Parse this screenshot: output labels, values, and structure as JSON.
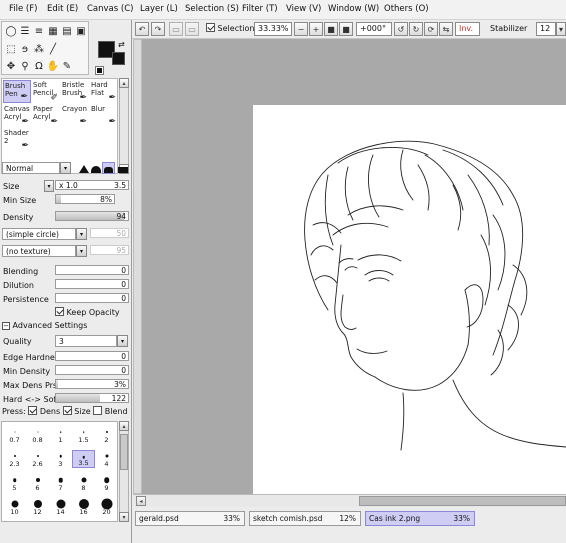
{
  "menu": [
    "File (F)",
    "Edit (E)",
    "Canvas (C)",
    "Layer (L)",
    "Selection (S)",
    "Filter (T)",
    "View (V)",
    "Window (W)",
    "Others (O)"
  ],
  "toolbar": {
    "selection_label": "Selection",
    "zoom": "33.33%",
    "rotation": "+000°",
    "invert_label": "Inv.",
    "stabilizer_label": "Stabilizer",
    "stabilizer_value": "12"
  },
  "brushes": [
    {
      "l1": "Brush",
      "l2": "Pen",
      "selected": true
    },
    {
      "l1": "Soft",
      "l2": "Pencil",
      "selected": false
    },
    {
      "l1": "Bristle",
      "l2": "Brush",
      "selected": false
    },
    {
      "l1": "Hard",
      "l2": "Flat",
      "selected": false
    },
    {
      "l1": "Canvas",
      "l2": "Acryl",
      "selected": false
    },
    {
      "l1": "Paper",
      "l2": "Acryl",
      "selected": false
    },
    {
      "l1": "Crayon",
      "l2": "",
      "selected": false
    },
    {
      "l1": "Blur",
      "l2": "",
      "selected": false
    },
    {
      "l1": "Shader",
      "l2": "2",
      "selected": false
    }
  ],
  "blend_mode": "Normal",
  "props": {
    "size_label": "Size",
    "size_mult": "x 1.0",
    "size_value": "3.5",
    "min_size_label": "Min Size",
    "min_size_value": "8%",
    "min_size_fraction": 0.08,
    "density_label": "Density",
    "density_value": "94",
    "density_fraction": 0.94,
    "shape": "(simple circle)",
    "shape_value": "50",
    "texture": "(no texture)",
    "texture_value": "95",
    "blending_label": "Blending",
    "blending_value": "0",
    "dilution_label": "Dilution",
    "dilution_value": "0",
    "persistence_label": "Persistence",
    "persistence_value": "0",
    "keep_opacity_label": "Keep Opacity",
    "advanced_label": "Advanced Settings",
    "quality_label": "Quality",
    "quality_value": "3",
    "edge_label": "Edge Hardness",
    "edge_value": "0",
    "min_density_label": "Min Density",
    "min_density_value": "0",
    "max_dens_label": "Max Dens Prs.",
    "max_dens_value": "3%",
    "max_dens_fraction": 0.03,
    "hard_soft_label": "Hard <-> Soft",
    "hard_soft_value": "122",
    "hard_soft_fraction": 0.61,
    "press_label": "Press:",
    "press_dens": "Dens",
    "press_size": "Size",
    "press_blend": "Blend"
  },
  "size_grid": [
    {
      "label": "0.7",
      "d": 1
    },
    {
      "label": "0.8",
      "d": 1
    },
    {
      "label": "1",
      "d": 1.5
    },
    {
      "label": "1.5",
      "d": 1.5
    },
    {
      "label": "2",
      "d": 2
    },
    {
      "label": "2.3",
      "d": 2
    },
    {
      "label": "2.6",
      "d": 2
    },
    {
      "label": "3",
      "d": 2.5
    },
    {
      "label": "3.5",
      "d": 2.5,
      "sel": true
    },
    {
      "label": "4",
      "d": 3
    },
    {
      "label": "5",
      "d": 3.5
    },
    {
      "label": "6",
      "d": 4
    },
    {
      "label": "7",
      "d": 4.5
    },
    {
      "label": "8",
      "d": 5
    },
    {
      "label": "9",
      "d": 5.5
    },
    {
      "label": "10",
      "d": 7
    },
    {
      "label": "12",
      "d": 8
    },
    {
      "label": "14",
      "d": 9
    },
    {
      "label": "16",
      "d": 10
    },
    {
      "label": "20",
      "d": 11
    }
  ],
  "tabs": [
    {
      "name": "gerald.psd",
      "pct": "33%",
      "active": false
    },
    {
      "name": "sketch comish.psd",
      "pct": "12%",
      "active": false
    },
    {
      "name": "Cas ink 2.png",
      "pct": "33%",
      "active": true
    }
  ],
  "colors": {
    "selection_highlight": "#cfcdf4",
    "canvas_bg": "#a9a9a9",
    "invert_red": "#c0392b"
  }
}
